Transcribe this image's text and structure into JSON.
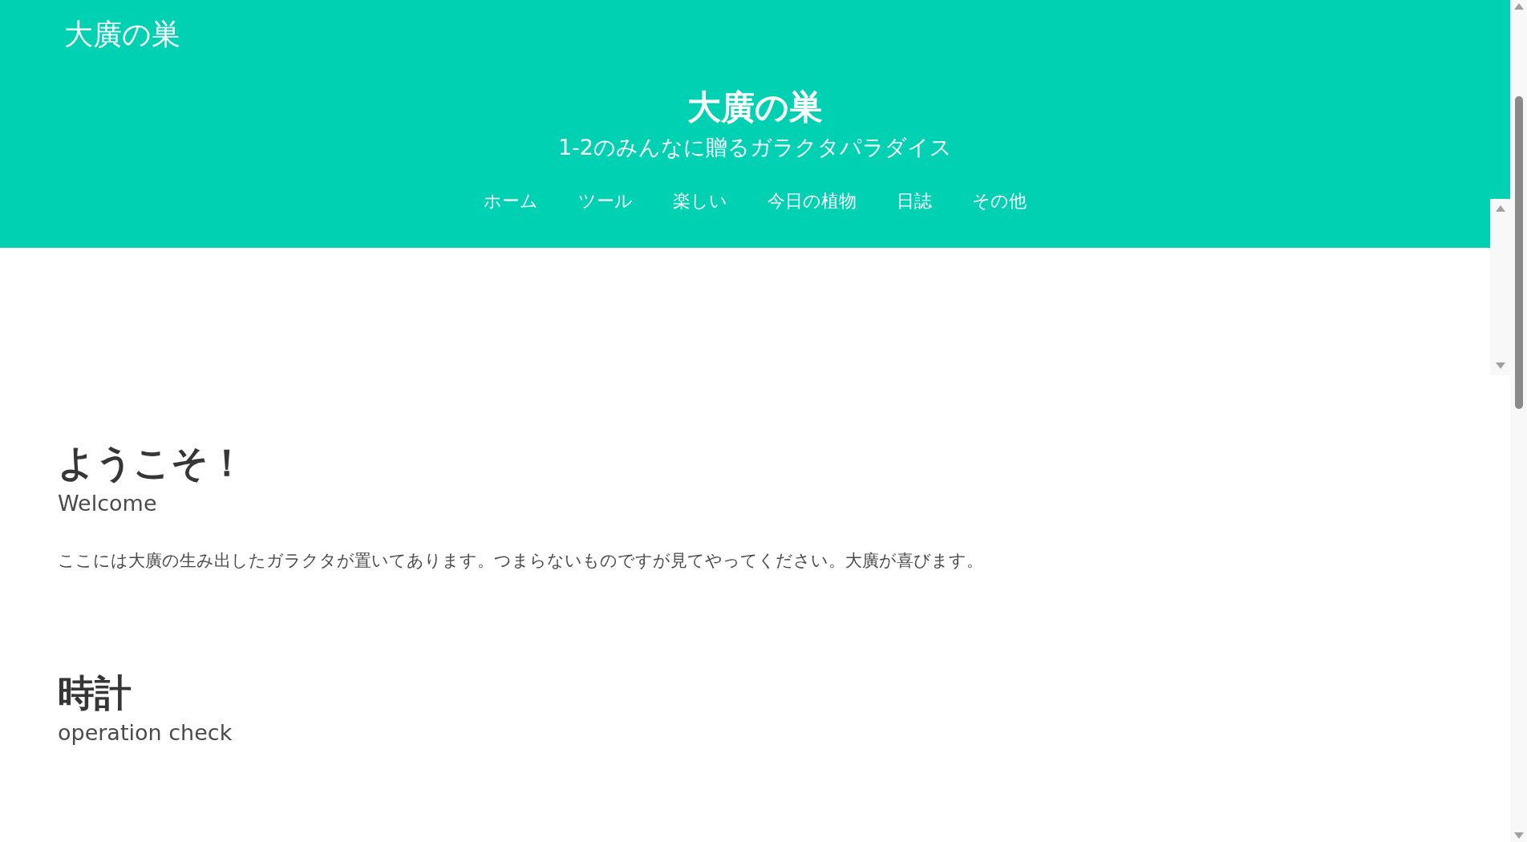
{
  "header": {
    "logo": "大廣の巣",
    "title": "大廣の巣",
    "subtitle": "1-2のみんなに贈るガラクタパラダイス",
    "nav": [
      {
        "label": "ホーム"
      },
      {
        "label": "ツール"
      },
      {
        "label": "楽しい"
      },
      {
        "label": "今日の植物"
      },
      {
        "label": "日誌"
      },
      {
        "label": "その他"
      }
    ]
  },
  "sections": [
    {
      "title": "ようこそ！",
      "subtitle": "Welcome",
      "text": "ここには大廣の生み出したガラクタが置いてあります。つまらないものですが見てやってください。大廣が喜びます。"
    },
    {
      "title": "時計",
      "subtitle": "operation check"
    }
  ]
}
